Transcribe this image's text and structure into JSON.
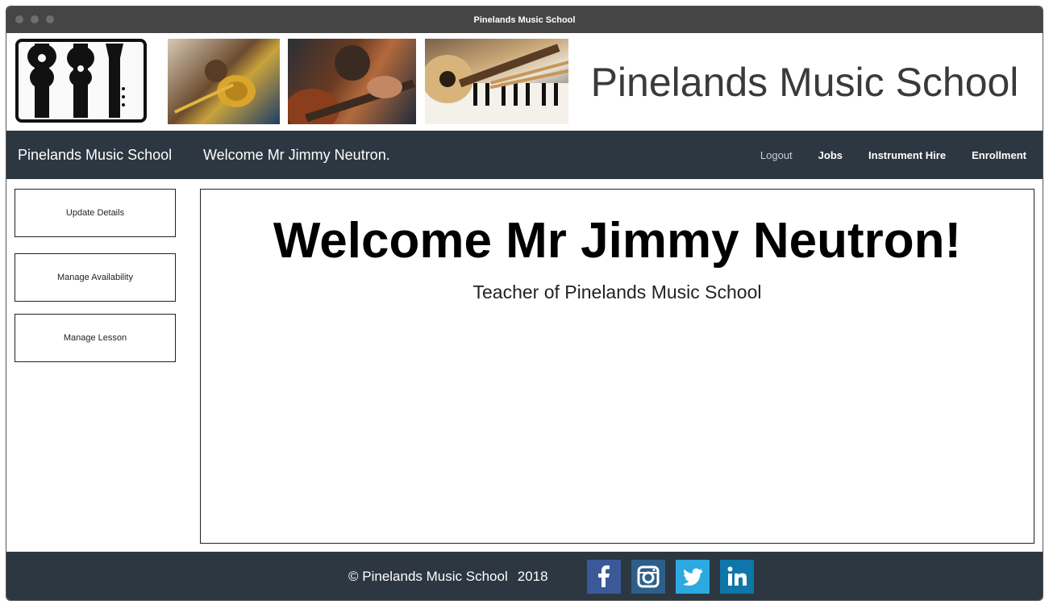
{
  "window": {
    "title": "Pinelands Music School"
  },
  "header": {
    "site_title": "Pinelands Music School"
  },
  "navbar": {
    "brand": "Pinelands Music School",
    "welcome": "Welcome Mr Jimmy Neutron.",
    "links": [
      {
        "label": "Logout"
      },
      {
        "label": "Jobs"
      },
      {
        "label": "Instrument Hire"
      },
      {
        "label": "Enrollment"
      }
    ]
  },
  "sidebar": {
    "items": [
      {
        "label": "Update Details"
      },
      {
        "label": "Manage Availability"
      },
      {
        "label": "Manage Lesson"
      }
    ]
  },
  "main": {
    "heading": "Welcome Mr Jimmy Neutron!",
    "subtitle": "Teacher of Pinelands Music School"
  },
  "footer": {
    "copyright": "© Pinelands Music School",
    "year": "2018",
    "social": [
      {
        "icon": "facebook-icon",
        "color": "#3b5998"
      },
      {
        "icon": "instagram-icon",
        "color": "#2e5f8a"
      },
      {
        "icon": "twitter-icon",
        "color": "#2da9e1"
      },
      {
        "icon": "linkedin-icon",
        "color": "#0e76a8"
      }
    ]
  },
  "colors": {
    "navbar_bg": "#2c3741",
    "titlebar_bg": "#454545"
  }
}
